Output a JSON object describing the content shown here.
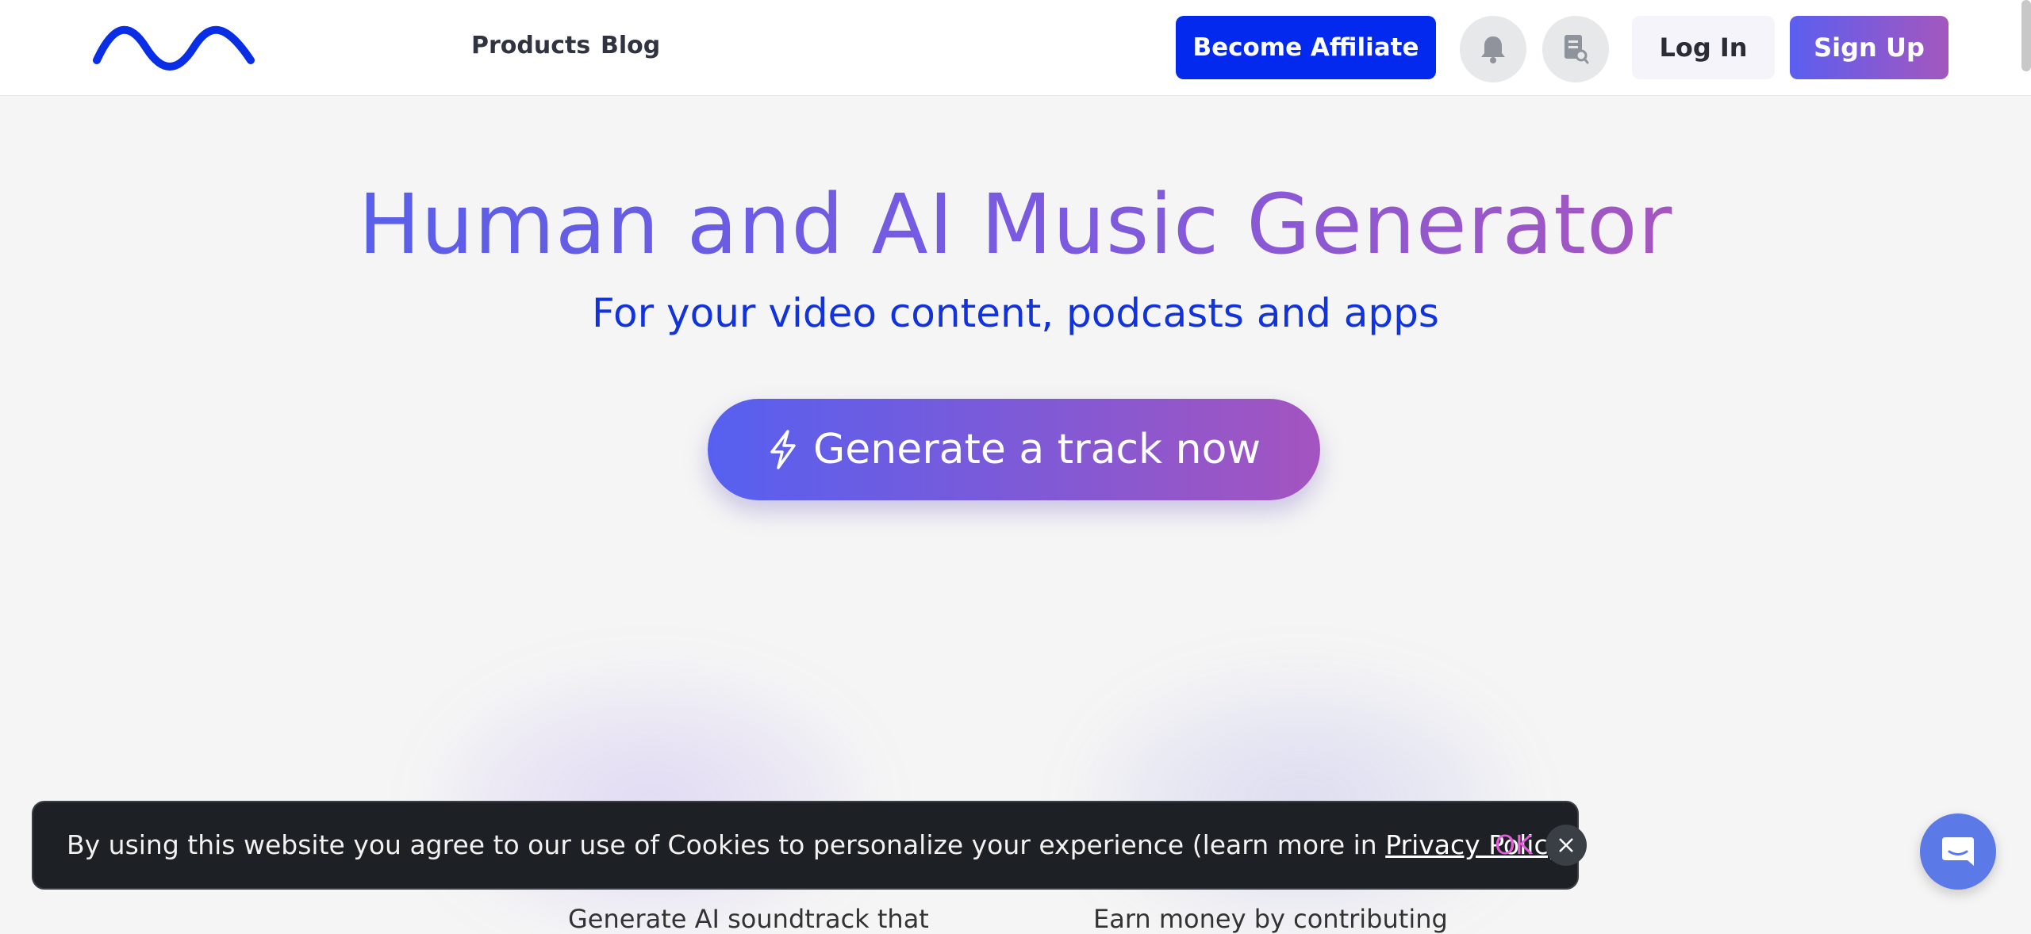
{
  "header": {
    "logo_icon": "wave-logo-icon",
    "nav": [
      {
        "label": "Products"
      },
      {
        "label": "Blog"
      }
    ],
    "affiliate_label": "Become Affiliate",
    "icons": [
      "bell-icon",
      "document-search-icon"
    ],
    "login_label": "Log In",
    "signup_label": "Sign Up"
  },
  "hero": {
    "title": "Human and AI Music Generator",
    "subtitle": "For your video content, podcasts and apps",
    "cta_icon": "lightning-icon",
    "cta_label": "Generate a track now"
  },
  "cards": [
    {
      "text": "Generate AI soundtrack that"
    },
    {
      "text": "Earn money by contributing"
    }
  ],
  "cookie_banner": {
    "text_before": "By using this website you agree to our use of Cookies to personalize your experience (learn more in ",
    "link_label": "Privacy Policy",
    "text_after": ")",
    "ok_label": "OK",
    "close_icon": "close-icon"
  },
  "chat_widget": {
    "icon": "chat-bubble-icon"
  },
  "colors": {
    "brand_blue": "#0328ee",
    "gradient_start": "#5b5ef0",
    "gradient_end": "#a457be",
    "cookie_bg": "#1d2125",
    "ok_pink": "#e65bd9"
  }
}
